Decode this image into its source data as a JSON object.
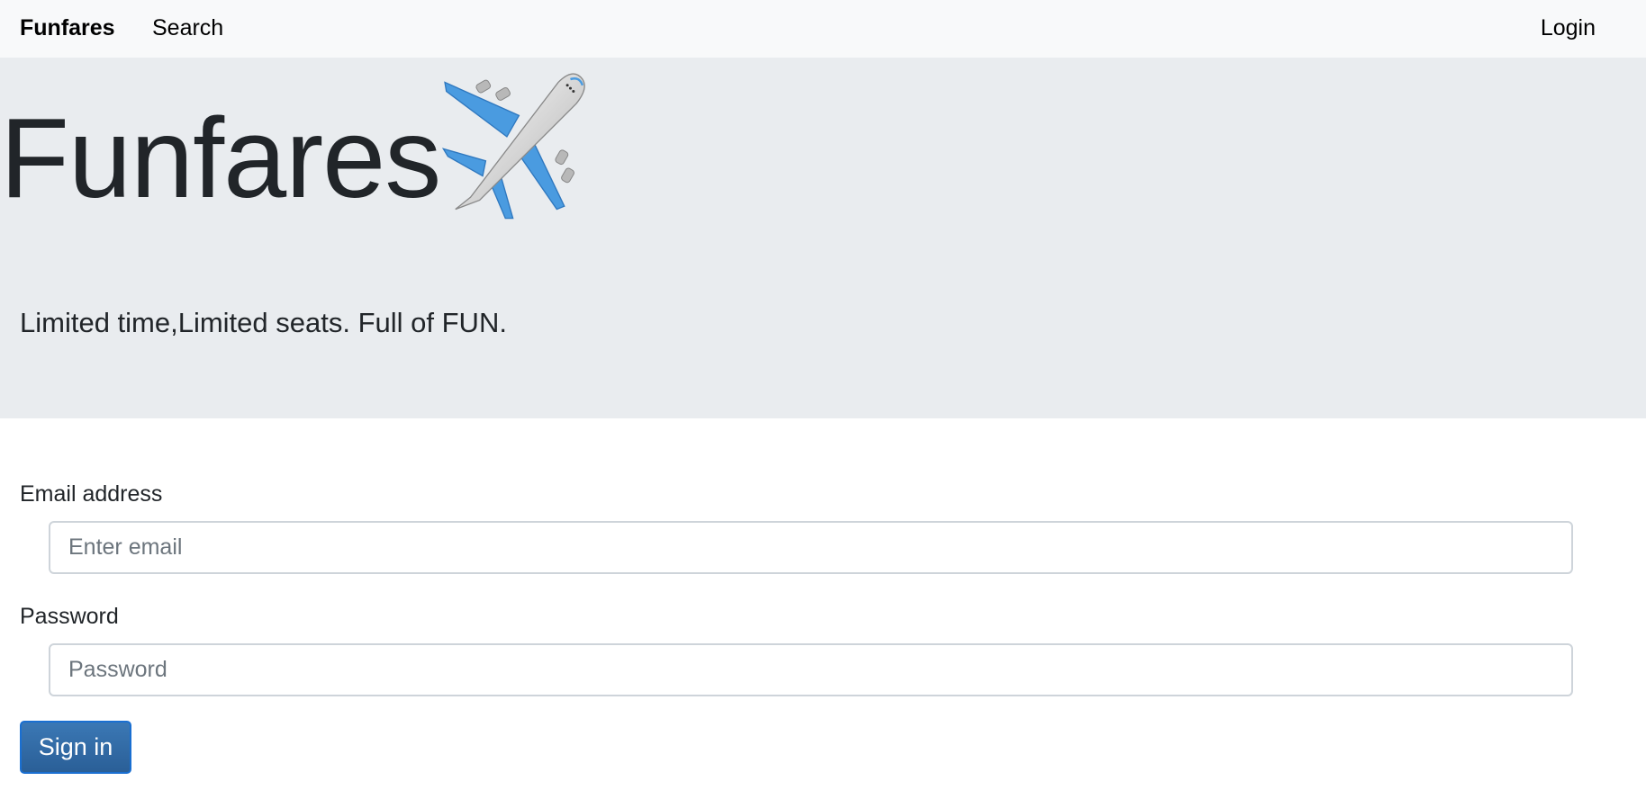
{
  "navbar": {
    "brand": "Funfares",
    "links": [
      {
        "label": "Search"
      }
    ],
    "login_label": "Login"
  },
  "hero": {
    "title": "Funfares",
    "icon": "airplane-icon",
    "tagline": "Limited time,Limited seats. Full of FUN."
  },
  "form": {
    "email": {
      "label": "Email address",
      "placeholder": "Enter email",
      "value": ""
    },
    "password": {
      "label": "Password",
      "placeholder": "Password",
      "value": ""
    },
    "submit_label": "Sign in"
  },
  "colors": {
    "navbar_bg": "#f8f9fa",
    "jumbotron_bg": "#e9ecef",
    "button_bg": "#2f6aa6",
    "button_border": "#1a6fd1",
    "plane_wing": "#4a9be0"
  }
}
